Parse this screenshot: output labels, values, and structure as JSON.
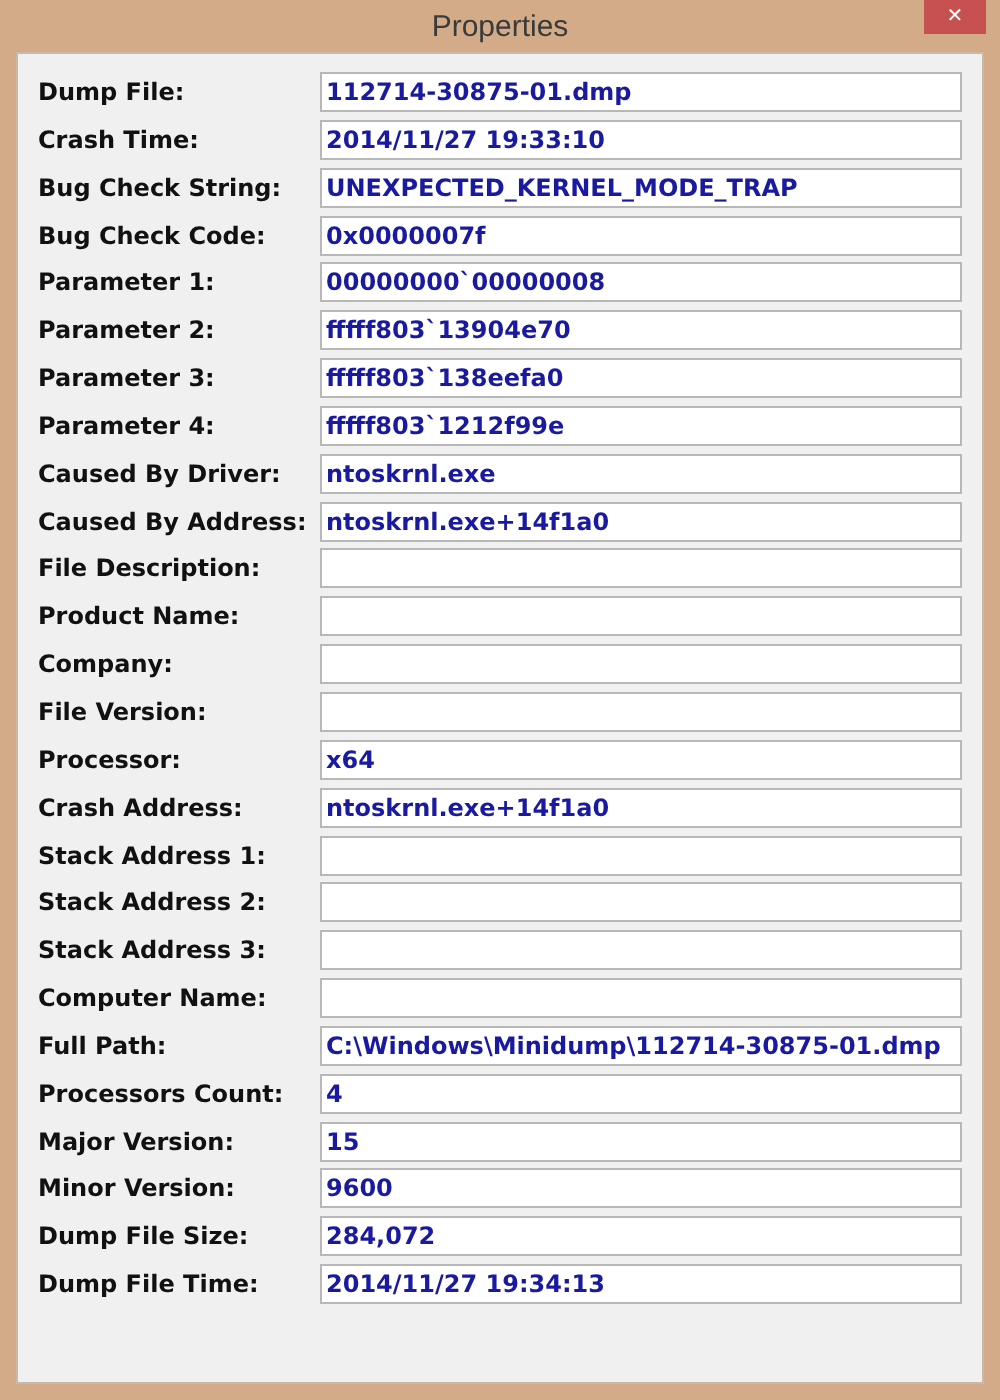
{
  "window": {
    "title": "Properties",
    "close": "✕"
  },
  "fields": [
    {
      "label": "Dump File:",
      "value": "112714-30875-01.dmp"
    },
    {
      "label": "Crash Time:",
      "value": "2014/11/27 19:33:10"
    },
    {
      "label": "Bug Check String:",
      "value": "UNEXPECTED_KERNEL_MODE_TRAP"
    },
    {
      "label": "Bug Check Code:",
      "value": "0x0000007f"
    },
    {
      "label": "Parameter 1:",
      "value": "00000000`00000008"
    },
    {
      "label": "Parameter 2:",
      "value": "fffff803`13904e70"
    },
    {
      "label": "Parameter 3:",
      "value": "fffff803`138eefa0"
    },
    {
      "label": "Parameter 4:",
      "value": "fffff803`1212f99e"
    },
    {
      "label": "Caused By Driver:",
      "value": "ntoskrnl.exe"
    },
    {
      "label": "Caused By Address:",
      "value": "ntoskrnl.exe+14f1a0"
    },
    {
      "label": "File Description:"
    },
    {
      "label": "Product Name:"
    },
    {
      "label": "Company:"
    },
    {
      "label": "File Version:"
    },
    {
      "label": "Processor:",
      "value": "x64"
    },
    {
      "label": "Crash Address:",
      "value": "ntoskrnl.exe+14f1a0"
    },
    {
      "label": "Stack Address 1:"
    },
    {
      "label": "Stack Address 2:"
    },
    {
      "label": "Stack Address 3:"
    },
    {
      "label": "Computer Name:"
    },
    {
      "label": "Full Path:",
      "value": "C:\\Windows\\Minidump\\112714-30875-01.dmp"
    },
    {
      "label": "Processors Count:",
      "value": "4"
    },
    {
      "label": "Major Version:",
      "value": "15"
    },
    {
      "label": "Minor Version:",
      "value": "9600"
    },
    {
      "label": "Dump File Size:",
      "value": "284,072"
    },
    {
      "label": "Dump File Time:",
      "value": "2014/11/27 19:34:13"
    }
  ]
}
